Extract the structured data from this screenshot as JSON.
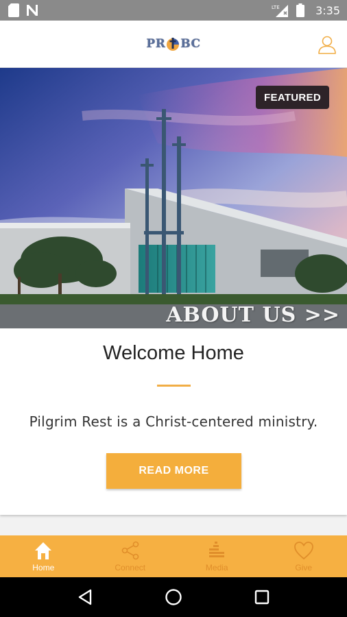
{
  "status_bar": {
    "time": "3:35",
    "network_label": "LTE",
    "icons": [
      "sd-card-icon",
      "notification-n-icon",
      "signal-icon",
      "battery-icon"
    ]
  },
  "header": {
    "logo_text_left": "PR",
    "logo_text_right": "BC",
    "profile_icon": "person-outline-icon"
  },
  "featured": {
    "badge": "FEATURED",
    "image_caption": "ABOUT US >>",
    "title": "Welcome Home",
    "body": "Pilgrim Rest is a Christ-centered ministry.",
    "button_label": "READ MORE"
  },
  "tabs": [
    {
      "label": "Home",
      "icon": "home-icon",
      "active": true
    },
    {
      "label": "Connect",
      "icon": "share-icon",
      "active": false
    },
    {
      "label": "Media",
      "icon": "media-icon",
      "active": false
    },
    {
      "label": "Give",
      "icon": "heart-icon",
      "active": false
    }
  ],
  "colors": {
    "accent": "#f4ae3c",
    "tab_bar": "#f6b042",
    "divider": "#f1ad45",
    "badge_bg": "#2d2328",
    "status_bar": "#8a8a8a"
  }
}
